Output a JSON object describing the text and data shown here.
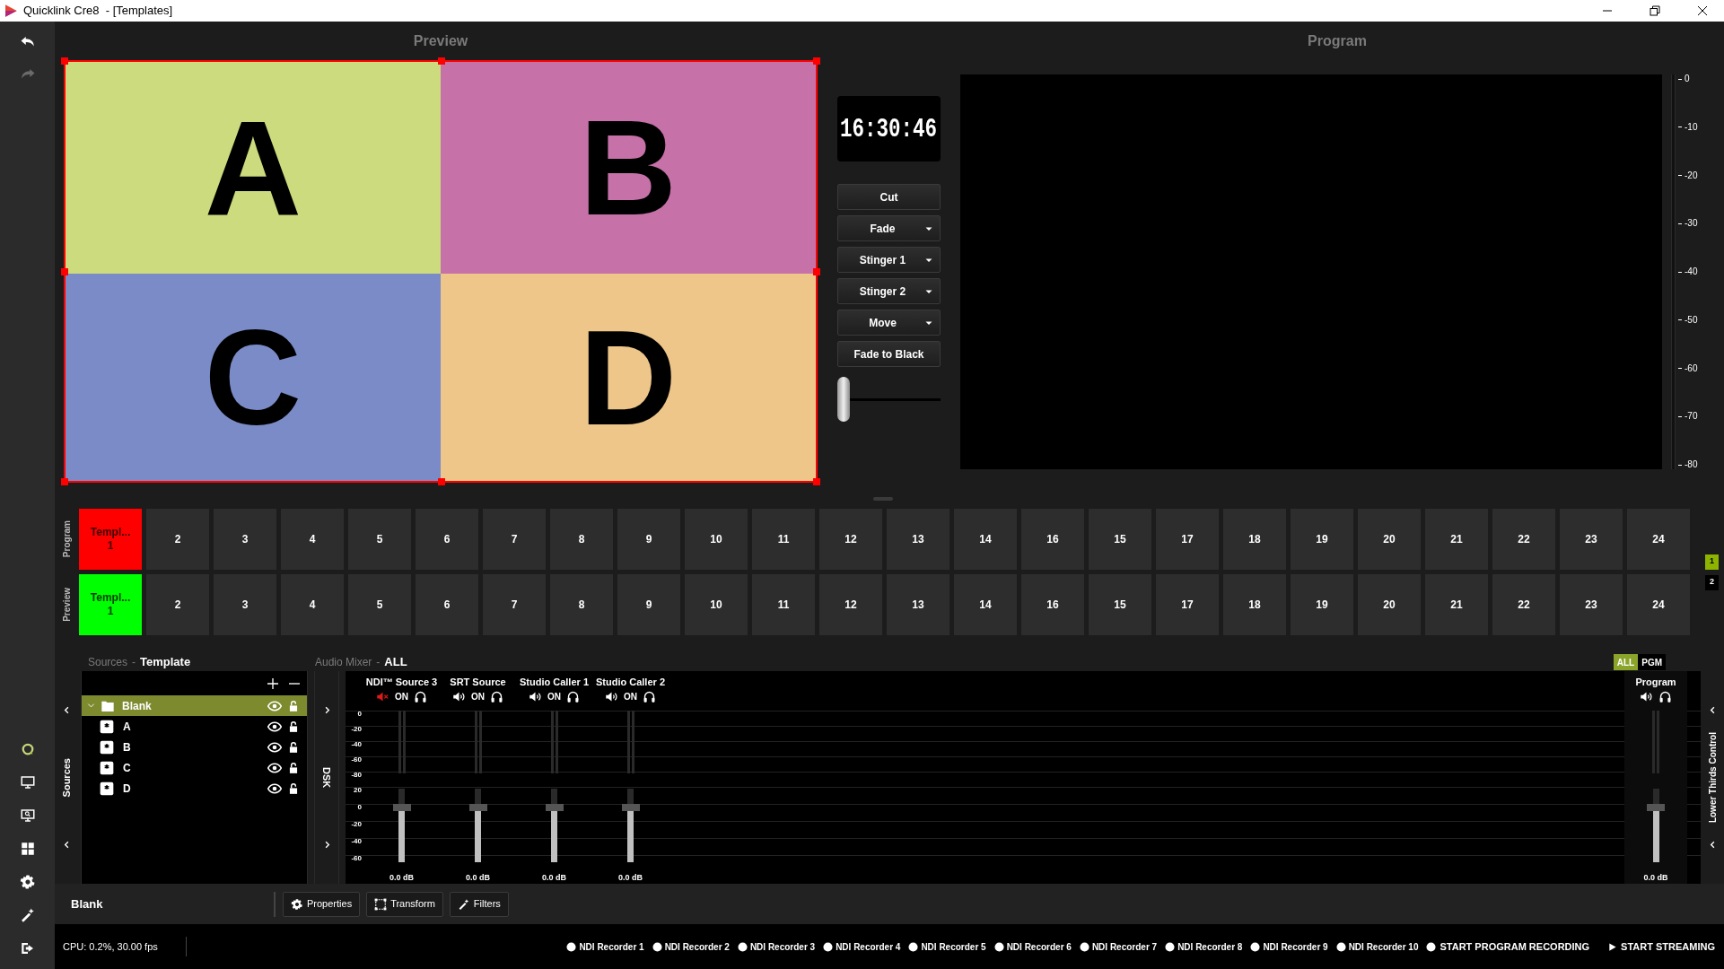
{
  "window": {
    "title": "Quicklink Cre8  - [Templates]"
  },
  "preview": {
    "title": "Preview",
    "tiles": [
      {
        "label": "A",
        "color": "#cbdb7d"
      },
      {
        "label": "B",
        "color": "#c671a8"
      },
      {
        "label": "C",
        "color": "#7a8bc8"
      },
      {
        "label": "D",
        "color": "#eec68a"
      }
    ]
  },
  "transitions": {
    "clock": "16:30:46",
    "buttons": [
      {
        "label": "Cut",
        "dropdown": false
      },
      {
        "label": "Fade",
        "dropdown": true
      },
      {
        "label": "Stinger 1",
        "dropdown": true
      },
      {
        "label": "Stinger 2",
        "dropdown": true
      },
      {
        "label": "Move",
        "dropdown": true
      },
      {
        "label": "Fade to Black",
        "dropdown": false
      }
    ],
    "t_bar": {
      "level": 0
    }
  },
  "program": {
    "title": "Program",
    "meter_ticks": [
      "0",
      "-10",
      "-20",
      "-30",
      "-40",
      "-50",
      "-60",
      "-70",
      "-80"
    ]
  },
  "scene_rows": [
    {
      "kind": "program",
      "label": "Program",
      "buttons": [
        {
          "label": "Templ...",
          "sub": "1",
          "selected": true
        },
        {
          "label": "2",
          "selected": false
        },
        {
          "label": "3",
          "selected": false
        },
        {
          "label": "4",
          "selected": false
        },
        {
          "label": "5",
          "selected": false
        },
        {
          "label": "6",
          "selected": false
        },
        {
          "label": "7",
          "selected": false
        },
        {
          "label": "8",
          "selected": false
        },
        {
          "label": "9",
          "selected": false
        },
        {
          "label": "10",
          "selected": false
        },
        {
          "label": "11",
          "selected": false
        },
        {
          "label": "12",
          "selected": false
        },
        {
          "label": "13",
          "selected": false
        },
        {
          "label": "14",
          "selected": false
        },
        {
          "label": "16",
          "selected": false
        },
        {
          "label": "15",
          "selected": false
        },
        {
          "label": "17",
          "selected": false
        },
        {
          "label": "18",
          "selected": false
        },
        {
          "label": "19",
          "selected": false
        },
        {
          "label": "20",
          "selected": false
        },
        {
          "label": "21",
          "selected": false
        },
        {
          "label": "22",
          "selected": false
        },
        {
          "label": "23",
          "selected": false
        },
        {
          "label": "24",
          "selected": false
        }
      ]
    },
    {
      "kind": "preview",
      "label": "Preview",
      "buttons": [
        {
          "label": "Templ...",
          "sub": "1",
          "selected": true
        },
        {
          "label": "2",
          "selected": false
        },
        {
          "label": "3",
          "selected": false
        },
        {
          "label": "4",
          "selected": false
        },
        {
          "label": "5",
          "selected": false
        },
        {
          "label": "6",
          "selected": false
        },
        {
          "label": "7",
          "selected": false
        },
        {
          "label": "8",
          "selected": false
        },
        {
          "label": "9",
          "selected": false
        },
        {
          "label": "10",
          "selected": false
        },
        {
          "label": "11",
          "selected": false
        },
        {
          "label": "12",
          "selected": false
        },
        {
          "label": "13",
          "selected": false
        },
        {
          "label": "14",
          "selected": false
        },
        {
          "label": "16",
          "selected": false
        },
        {
          "label": "15",
          "selected": false
        },
        {
          "label": "17",
          "selected": false
        },
        {
          "label": "18",
          "selected": false
        },
        {
          "label": "19",
          "selected": false
        },
        {
          "label": "20",
          "selected": false
        },
        {
          "label": "21",
          "selected": false
        },
        {
          "label": "22",
          "selected": false
        },
        {
          "label": "23",
          "selected": false
        },
        {
          "label": "24",
          "selected": false
        }
      ]
    }
  ],
  "pages": [
    {
      "label": "1",
      "selected": true
    },
    {
      "label": "2",
      "selected": false
    }
  ],
  "sources": {
    "title": "Sources",
    "separator": "-",
    "context": "Template",
    "tab": "Sources",
    "tree": [
      {
        "label": "Blank",
        "expanded": true,
        "selected": true,
        "children": [
          {
            "label": "A",
            "selected": false
          },
          {
            "label": "B",
            "selected": false
          },
          {
            "label": "C",
            "selected": false
          },
          {
            "label": "D",
            "selected": false
          }
        ]
      }
    ]
  },
  "dsk": {
    "label": "DSK"
  },
  "audio_mixer": {
    "title": "Audio Mixer",
    "separator": "-",
    "filter": "ALL",
    "toggles": [
      {
        "label": "ALL",
        "selected": true
      },
      {
        "label": "PGM",
        "selected": false
      }
    ],
    "meter_scale": [
      "0",
      "-20",
      "-40",
      "-60",
      "-80"
    ],
    "fader_scale": [
      "20",
      "0",
      "-20",
      "-40",
      "-60"
    ],
    "channels": [
      {
        "name": "NDI™ Source 3",
        "muted": true,
        "status": "ON",
        "level": 0.75,
        "reading": "0.0 dB"
      },
      {
        "name": "SRT Source",
        "muted": false,
        "status": "ON",
        "level": 0.75,
        "reading": "0.0 dB"
      },
      {
        "name": "Studio Caller 1",
        "muted": false,
        "status": "ON",
        "level": 0.75,
        "reading": "0.0 dB"
      },
      {
        "name": "Studio Caller 2",
        "muted": false,
        "status": "ON",
        "level": 0.75,
        "reading": "0.0 dB"
      }
    ],
    "program": {
      "name": "Program",
      "muted": false,
      "level": 0.75,
      "reading": "0.0 dB"
    }
  },
  "lower_thirds": {
    "label": "Lower Thirds Control"
  },
  "selection_bar": {
    "name": "Blank",
    "buttons": [
      {
        "kind": "properties",
        "label": "Properties"
      },
      {
        "kind": "transform",
        "label": "Transform"
      },
      {
        "kind": "filters",
        "label": "Filters"
      }
    ]
  },
  "status_bar": {
    "cpu": "CPU: 0.2%, 30.00 fps",
    "recorders": [
      {
        "label": "NDI Recorder 1"
      },
      {
        "label": "NDI Recorder 2"
      },
      {
        "label": "NDI Recorder 3"
      },
      {
        "label": "NDI Recorder 4"
      },
      {
        "label": "NDI Recorder 5"
      },
      {
        "label": "NDI Recorder 6"
      },
      {
        "label": "NDI Recorder 7"
      },
      {
        "label": "NDI Recorder 8"
      },
      {
        "label": "NDI Recorder 9"
      },
      {
        "label": "NDI Recorder 10"
      }
    ],
    "record": "START PROGRAM RECORDING",
    "stream": "START STREAMING"
  }
}
